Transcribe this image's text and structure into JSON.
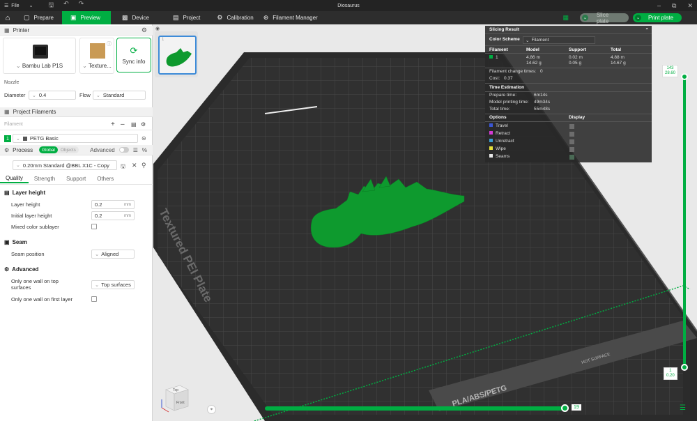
{
  "titlebar": {
    "menu_label": "File",
    "window_title": "Diosaurus"
  },
  "nav": {
    "tabs": [
      {
        "label": "Prepare",
        "icon": "cube-icon"
      },
      {
        "label": "Preview",
        "icon": "preview-icon",
        "active": true
      },
      {
        "label": "Device",
        "icon": "monitor-icon"
      },
      {
        "label": "Project",
        "icon": "project-icon"
      },
      {
        "label": "Calibration",
        "icon": "calibration-icon"
      },
      {
        "label": "Filament Manager",
        "icon": "filament-manager-icon"
      }
    ],
    "slice_label": "Slice plate",
    "print_label": "Print plate"
  },
  "printer": {
    "section_title": "Printer",
    "printer_name": "Bambu Lab P1S",
    "plate_name": "Texture...",
    "sync_label": "Sync info",
    "nozzle_label": "Nozzle",
    "diameter_label": "Diameter",
    "diameter_value": "0.4",
    "flow_label": "Flow",
    "flow_value": "Standard"
  },
  "filaments": {
    "section_title": "Project Filaments",
    "filament_label": "Filament",
    "items": [
      {
        "index": "1",
        "name": "PETG Basic",
        "color": "#00ae42"
      }
    ]
  },
  "process": {
    "section_title": "Process",
    "global_label": "Global",
    "objects_label": "Objects",
    "advanced_label": "Advanced",
    "preset": "0.20mm Standard @BBL X1C - Copy",
    "tabs": [
      "Quality",
      "Strength",
      "Support",
      "Others"
    ],
    "groups": {
      "layer_height_title": "Layer height",
      "layer_height_label": "Layer height",
      "layer_height_value": "0.2",
      "initial_layer_height_label": "Initial layer height",
      "initial_layer_height_value": "0.2",
      "unit_mm": "mm",
      "mixed_color_label": "Mixed color sublayer",
      "seam_title": "Seam",
      "seam_position_label": "Seam position",
      "seam_position_value": "Aligned",
      "advanced_title": "Advanced",
      "one_wall_top_label_1": "Only one wall on top",
      "one_wall_top_label_2": "surfaces",
      "one_wall_top_value": "Top surfaces",
      "one_wall_first_label": "Only one wall on first layer"
    }
  },
  "slicing": {
    "title": "Slicing Result",
    "color_scheme_label": "Color Scheme",
    "color_scheme_value": "Filament",
    "columns": [
      "Filament",
      "Model",
      "Support",
      "Total"
    ],
    "filament_row": {
      "index": "1",
      "model_len": "4.86 m",
      "model_wt": "14.62 g",
      "support_len": "0.02 m",
      "support_wt": "0.05 g",
      "total_len": "4.88 m",
      "total_wt": "14.67 g"
    },
    "change_times_label": "Filament change times:",
    "change_times_value": "0",
    "cost_label": "Cost:",
    "cost_value": "0.37",
    "time_title": "Time Estimation",
    "prepare_label": "Prepare time:",
    "prepare_value": "6m14s",
    "model_time_label": "Model printing time:",
    "model_time_value": "49m34s",
    "total_time_label": "Total time:",
    "total_time_value": "55m48s",
    "options_label": "Options",
    "display_label": "Display",
    "options": [
      {
        "label": "Travel",
        "color": "#3a56d4"
      },
      {
        "label": "Retract",
        "color": "#d43ad4"
      },
      {
        "label": "Unretract",
        "color": "#3aa0d4"
      },
      {
        "label": "Wipe",
        "color": "#e6e23a"
      },
      {
        "label": "Seams",
        "color": "#e6e6e6"
      }
    ]
  },
  "plate": {
    "label": "Textured PEI Plate",
    "bottom_label": "PLA/ABS/PETG",
    "hot_label": "HOT SURFACE"
  },
  "layers": {
    "top_layer": "143",
    "top_height": "28.60",
    "bottom_layer": "1",
    "bottom_height": "0.20",
    "move_value": "19",
    "top_fraction": 1.0,
    "move_fraction": 0.98
  },
  "viewcube": {
    "top": "Top",
    "front": "Front"
  },
  "thumbnail_index": "1",
  "colors": {
    "accent": "#00ae42",
    "model": "#0e9a2e",
    "bed": "#2f2f2f"
  }
}
